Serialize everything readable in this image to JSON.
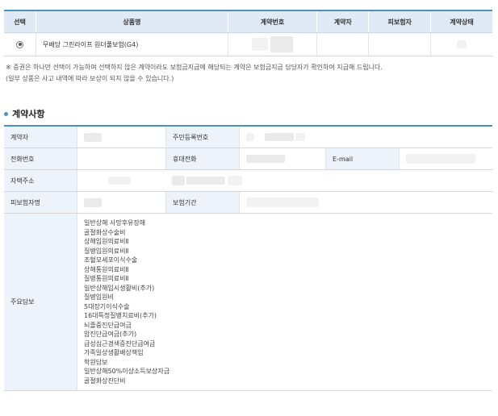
{
  "product_table": {
    "headers": [
      "선택",
      "상품명",
      "계약번호",
      "계약자",
      "피보험자",
      "계약상태"
    ],
    "row": {
      "product_name": "무배당 그린라이프 원더풀보험(G4)"
    }
  },
  "notice": {
    "line1": "※ 증권은 하나만 선택이 가능하며 선택하지 않은 계약이라도 보험금지급에 해당되는 계약은 보험금지급 담당자가 확인하여 지급해 드립니다.",
    "line2": "(일부 상품은 사고 내역에 따라 보상이 되지 않을 수 있습니다.)"
  },
  "section_title": "계약사항",
  "details": {
    "contractor_label": "계약자",
    "resident_no_label": "주민등록번호",
    "phone_label": "전화번호",
    "mobile_label": "휴대전화",
    "email_label": "E-mail",
    "address_label": "자택주소",
    "insured_label": "피보험자명",
    "period_label": "보험기간",
    "coverage_label": "주요담보",
    "coverages": [
      "일반상해 사망후유장해",
      "골절화상수술비",
      "상해입원의료비Ⅱ",
      "질병입원의료비Ⅱ",
      "조혈모세포이식수술",
      "상해통원의료비Ⅱ",
      "질병통원의료비Ⅱ",
      "일반상해입시생활비(추가)",
      "질병입원비",
      "5대장기이식수술",
      "16대특정질병치료비(추가)",
      "뇌졸중진단급여금",
      "암진단급여금(추가)",
      "급성심근경색증진단급여금",
      "가족일상생활배상책임",
      "학원담보",
      "일반상해50%이상소득보상자금",
      "골절화상진단비"
    ]
  },
  "colors": {
    "accent": "#4a90c8",
    "header_bg": "#dfeaf6",
    "label_bg": "#edf3fa"
  }
}
